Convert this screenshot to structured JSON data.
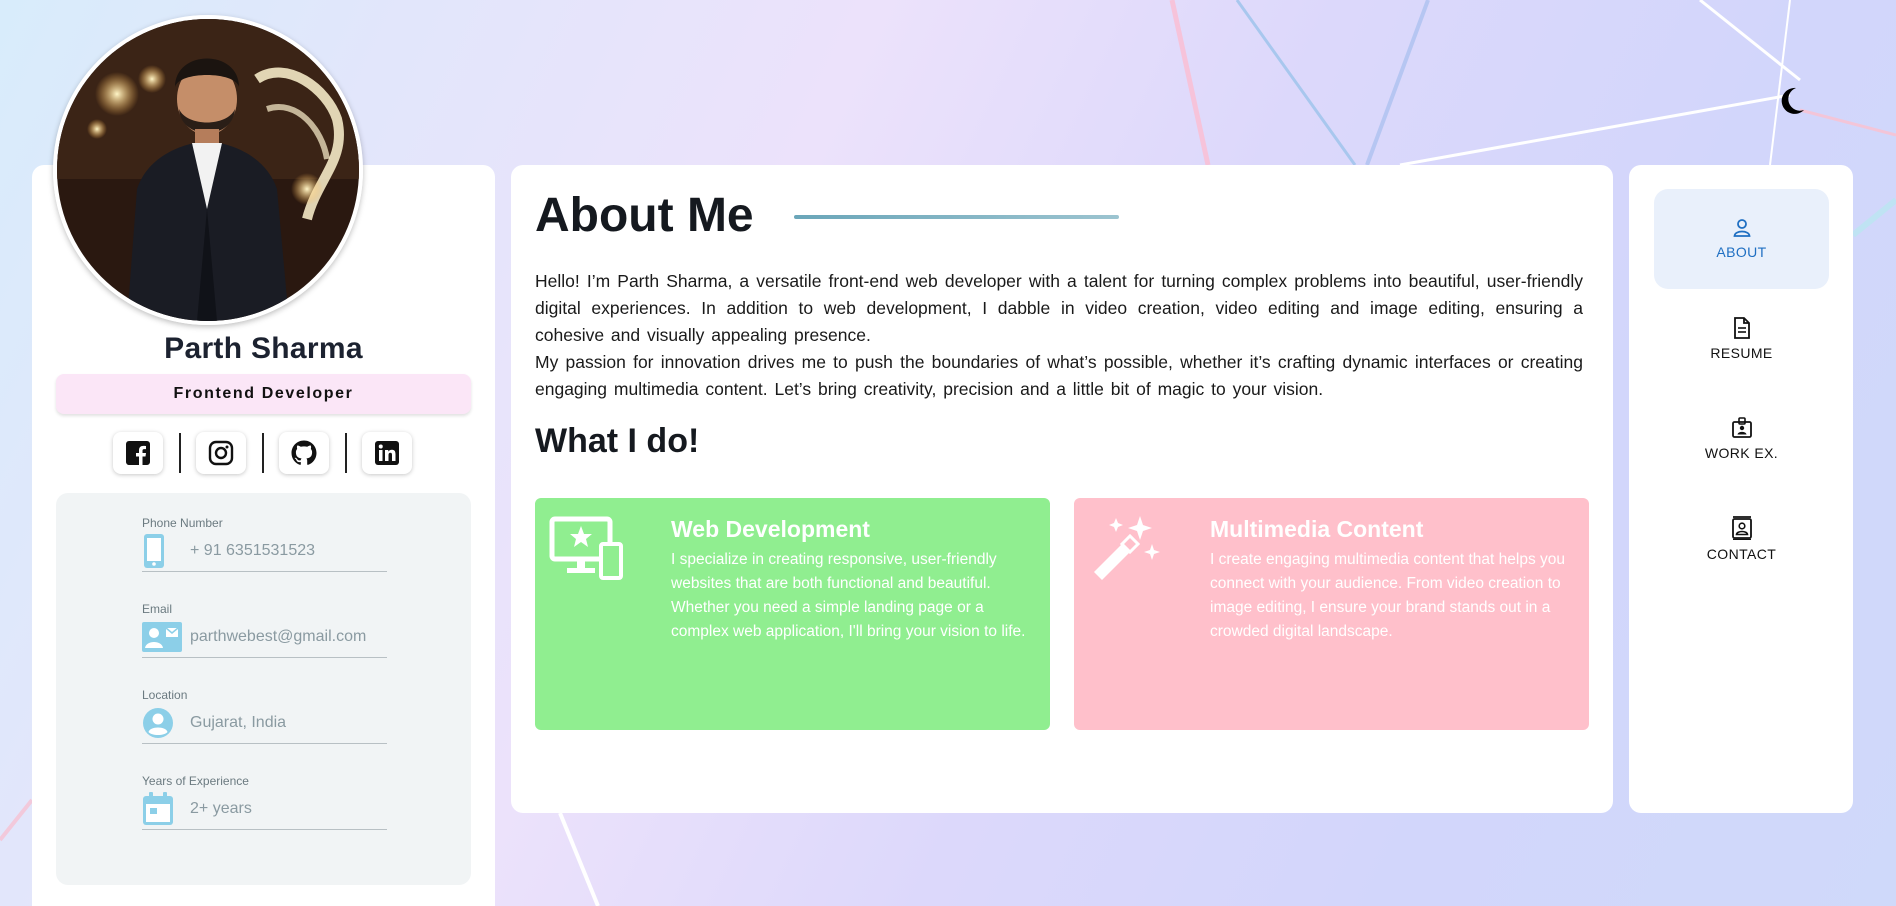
{
  "theme_toggle": {
    "icon": "moon-icon"
  },
  "profile": {
    "name": "Parth Sharma",
    "role": "Frontend Developer",
    "photo_icon": "profile-photo",
    "socials": [
      {
        "name": "facebook",
        "icon": "facebook-icon"
      },
      {
        "name": "instagram",
        "icon": "instagram-icon"
      },
      {
        "name": "github",
        "icon": "github-icon"
      },
      {
        "name": "linkedin",
        "icon": "linkedin-icon"
      }
    ],
    "info": [
      {
        "label": "Phone Number",
        "value": "+ 91 6351531523",
        "icon": "phone-icon"
      },
      {
        "label": "Email",
        "value": "parthwebest@gmail.com",
        "icon": "contact-card-icon"
      },
      {
        "label": "Location",
        "value": "Gujarat, India",
        "icon": "person-circle-icon"
      },
      {
        "label": "Years of Experience",
        "value": "2+ years",
        "icon": "calendar-icon"
      }
    ]
  },
  "about": {
    "title": "About Me",
    "paragraphs": [
      "Hello! I’m Parth Sharma, a versatile front-end web developer with a talent for turning complex problems into beautiful, user-friendly digital experiences. In addition to web development, I dabble in video creation, video editing and image editing, ensuring a cohesive and visually appealing presence.",
      "My passion for innovation drives me to push the boundaries of what’s possible, whether it’s crafting dynamic interfaces or creating engaging multimedia content. Let’s bring creativity, precision and a little bit of magic to your vision."
    ],
    "services_title": "What I do!",
    "services": [
      {
        "title": "Web Development",
        "description": "I specialize in creating responsive, user-friendly websites that are both functional and beautiful. Whether you need a simple landing page or a complex web application, I'll bring your vision to life.",
        "icon": "desktop-mobile-icon",
        "color": "#90ee90"
      },
      {
        "title": "Multimedia Content",
        "description": "I create engaging multimedia content that helps you connect with your audience. From video creation to image editing, I ensure your brand stands out in a crowded digital landscape.",
        "icon": "magic-wand-icon",
        "color": "#ffc0cb"
      }
    ]
  },
  "nav": {
    "items": [
      {
        "label": "ABOUT",
        "icon": "user-icon",
        "active": true
      },
      {
        "label": "RESUME",
        "icon": "document-icon",
        "active": false
      },
      {
        "label": "WORK EX.",
        "icon": "id-badge-icon",
        "active": false
      },
      {
        "label": "CONTACT",
        "icon": "contact-book-icon",
        "active": false
      }
    ]
  },
  "colors": {
    "active_nav": "#1f6fc2",
    "active_nav_bg": "#e9f0fb",
    "role_badge_bg": "#fbe6f7",
    "info_panel_bg": "#f1f4f5"
  }
}
